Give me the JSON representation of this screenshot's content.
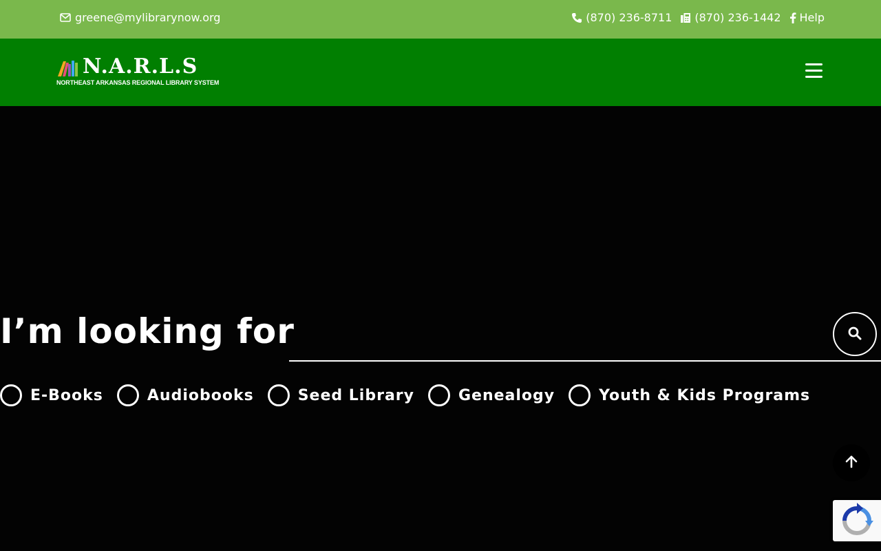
{
  "topbar": {
    "email": "greene@mylibrarynow.org",
    "phone": "(870) 236-8711",
    "fax": "(870) 236-1442",
    "help": "Help"
  },
  "header": {
    "logo_name": "N.A.R.L.S",
    "logo_tagline": "NORTHEAST ARKANSAS REGIONAL LIBRARY SYSTEM"
  },
  "search": {
    "label": "I’m looking for",
    "placeholder": ""
  },
  "options": [
    {
      "label": "E-Books"
    },
    {
      "label": "Audiobooks"
    },
    {
      "label": "Seed Library"
    },
    {
      "label": "Genealogy"
    },
    {
      "label": "Youth & Kids Programs"
    }
  ],
  "colors": {
    "topbar_bg": "#7ab84c",
    "header_bg": "#017f01",
    "hero_bg": "#030303"
  },
  "icons": [
    "envelope-icon",
    "phone-icon",
    "fax-icon",
    "facebook-icon",
    "hamburger-menu-icon",
    "search-icon",
    "arrow-up-icon",
    "recaptcha-icon"
  ]
}
